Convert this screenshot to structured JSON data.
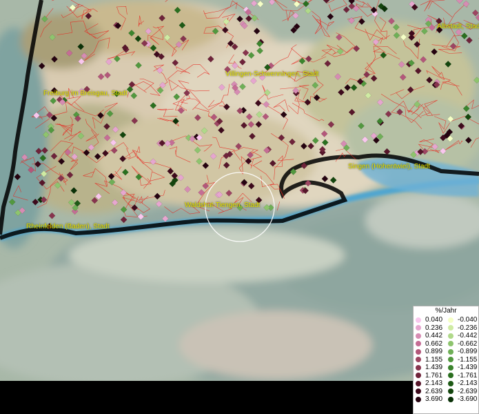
{
  "map": {
    "places": [
      {
        "id": "albstadt",
        "label": "Albstadt, Stadt"
      },
      {
        "id": "villingen",
        "label": "Villingen-Schwenningen, Stadt"
      },
      {
        "id": "freiburg",
        "label": "Freiburg im Breisgau, Stadt"
      },
      {
        "id": "singen",
        "label": "Singen (Hohentwiel), Stadt"
      },
      {
        "id": "waldshut",
        "label": "Waldshut-Tiengen, Stadt"
      },
      {
        "id": "rheinfelden",
        "label": "Rheinfelden (Baden), Stadt"
      }
    ]
  },
  "legend": {
    "title": "%/Jahr",
    "positive": {
      "values": [
        "0.040",
        "0.236",
        "0.442",
        "0.662",
        "0.899",
        "1.155",
        "1.439",
        "1.761",
        "2.143",
        "2.639",
        "3.690"
      ],
      "colors": [
        "#f9c7ee",
        "#e6a6cf",
        "#d68cb3",
        "#c56d95",
        "#b3577a",
        "#9d4562",
        "#87344e",
        "#6e233a",
        "#56162a",
        "#3d0a1c",
        "#250310"
      ]
    },
    "negative": {
      "values": [
        "-0.040",
        "-0.236",
        "-0.442",
        "-0.662",
        "-0.899",
        "-1.155",
        "-1.439",
        "-1.761",
        "-2.143",
        "-2.639",
        "-3.690"
      ],
      "colors": [
        "#f5ffc6",
        "#cfeba3",
        "#b0d98a",
        "#8ec46e",
        "#6faf57",
        "#52983f",
        "#3b842d",
        "#2a6f1f",
        "#1e5a16",
        "#13450d",
        "#0a3107"
      ]
    }
  }
}
